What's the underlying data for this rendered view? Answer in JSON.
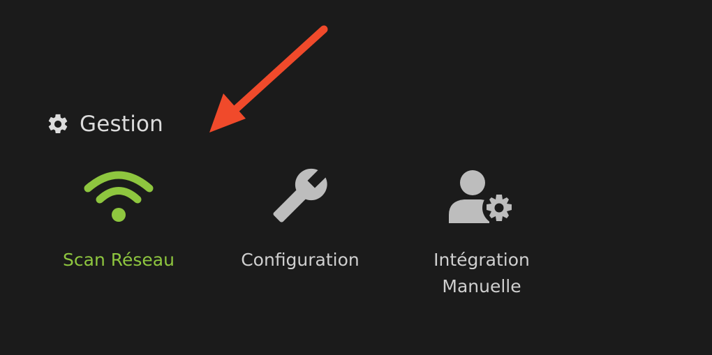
{
  "section": {
    "title": "Gestion",
    "icon": "gear-icon"
  },
  "tiles": [
    {
      "label": "Scan Réseau",
      "icon": "wifi-icon",
      "active": true,
      "color": "#8ec63f"
    },
    {
      "label": "Configuration",
      "icon": "wrench-icon",
      "active": false,
      "color": "#bdbdbd"
    },
    {
      "label": "Intégration\nManuelle",
      "icon": "user-gear-icon",
      "active": false,
      "color": "#bdbdbd"
    }
  ],
  "annotation": {
    "icon": "arrow-pointer",
    "color": "#f04a2b"
  },
  "colors": {
    "background": "#1b1b1b",
    "accent": "#8ec63f",
    "text": "#cfcfcf"
  }
}
